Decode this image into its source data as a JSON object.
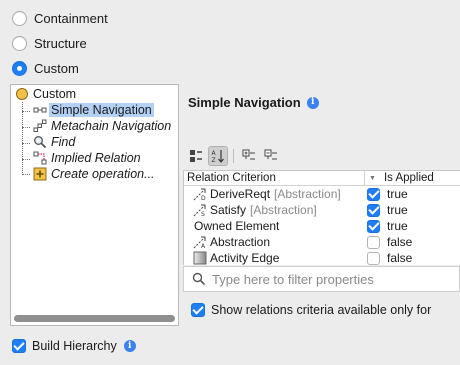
{
  "radios": [
    {
      "label": "Containment",
      "selected": false
    },
    {
      "label": "Structure",
      "selected": false
    },
    {
      "label": "Custom",
      "selected": true
    }
  ],
  "tree": {
    "root": "Custom",
    "items": [
      {
        "label": "Simple Navigation",
        "icon": "simple-navigation-icon",
        "selected": true
      },
      {
        "label": "Metachain Navigation",
        "icon": "metachain-navigation-icon",
        "selected": false
      },
      {
        "label": "Find",
        "icon": "find-icon",
        "selected": false
      },
      {
        "label": "Implied Relation",
        "icon": "implied-relation-icon",
        "selected": false
      },
      {
        "label": "Create operation...",
        "icon": "create-operation-icon",
        "selected": false
      }
    ]
  },
  "build_hierarchy": {
    "label": "Build Hierarchy",
    "checked": true
  },
  "panel": {
    "title": "Simple Navigation",
    "table": {
      "headers": {
        "criterion": "Relation Criterion",
        "applied": "Is Applied"
      },
      "rows": [
        {
          "name": "DeriveReqt",
          "sub": "[Abstraction]",
          "icon": "derive-reqt-icon",
          "checked": true,
          "value": "true"
        },
        {
          "name": "Satisfy",
          "sub": "[Abstraction]",
          "icon": "satisfy-icon",
          "checked": true,
          "value": "true"
        },
        {
          "name": "Owned Element",
          "sub": "",
          "icon": "",
          "checked": true,
          "value": "true"
        },
        {
          "name": "Abstraction",
          "sub": "",
          "icon": "abstraction-icon",
          "checked": false,
          "value": "false"
        },
        {
          "name": "Activity Edge",
          "sub": "",
          "icon": "activity-edge-icon",
          "checked": false,
          "value": "false"
        }
      ]
    },
    "filter": {
      "placeholder": "Type here to filter properties",
      "value": ""
    },
    "show_criteria": {
      "label": "Show relations criteria available only for",
      "checked": true
    }
  },
  "colors": {
    "accent": "#1e7ff5",
    "selection": "#b3d1f5",
    "info": "#3b82f0"
  }
}
